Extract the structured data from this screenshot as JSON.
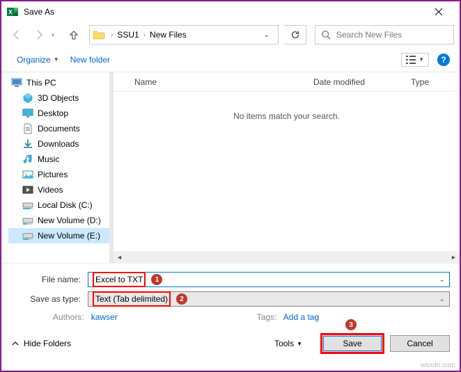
{
  "window": {
    "title": "Save As"
  },
  "nav": {
    "breadcrumbs": [
      "SSU1",
      "New Files"
    ],
    "search_placeholder": "Search New Files"
  },
  "toolbar": {
    "organize": "Organize",
    "new_folder": "New folder"
  },
  "tree": {
    "items": [
      {
        "label": "This PC",
        "icon": "pc"
      },
      {
        "label": "3D Objects",
        "icon": "3d"
      },
      {
        "label": "Desktop",
        "icon": "desktop"
      },
      {
        "label": "Documents",
        "icon": "documents"
      },
      {
        "label": "Downloads",
        "icon": "downloads"
      },
      {
        "label": "Music",
        "icon": "music"
      },
      {
        "label": "Pictures",
        "icon": "pictures"
      },
      {
        "label": "Videos",
        "icon": "videos"
      },
      {
        "label": "Local Disk (C:)",
        "icon": "disk"
      },
      {
        "label": "New Volume (D:)",
        "icon": "disk"
      },
      {
        "label": "New Volume (E:)",
        "icon": "disk",
        "selected": true
      }
    ]
  },
  "columns": {
    "name": "Name",
    "date": "Date modified",
    "type": "Type"
  },
  "empty_message": "No items match your search.",
  "form": {
    "file_name_label": "File name:",
    "file_name_value": "Excel to TXT",
    "save_type_label": "Save as type:",
    "save_type_value": "Text (Tab delimited)",
    "authors_label": "Authors:",
    "authors_value": "kawser",
    "tags_label": "Tags:",
    "tags_value": "Add a tag"
  },
  "footer": {
    "hide_folders": "Hide Folders",
    "tools": "Tools",
    "save": "Save",
    "cancel": "Cancel"
  },
  "annotations": {
    "a1": "1",
    "a2": "2",
    "a3": "3"
  },
  "watermark": "wsxdn.com"
}
